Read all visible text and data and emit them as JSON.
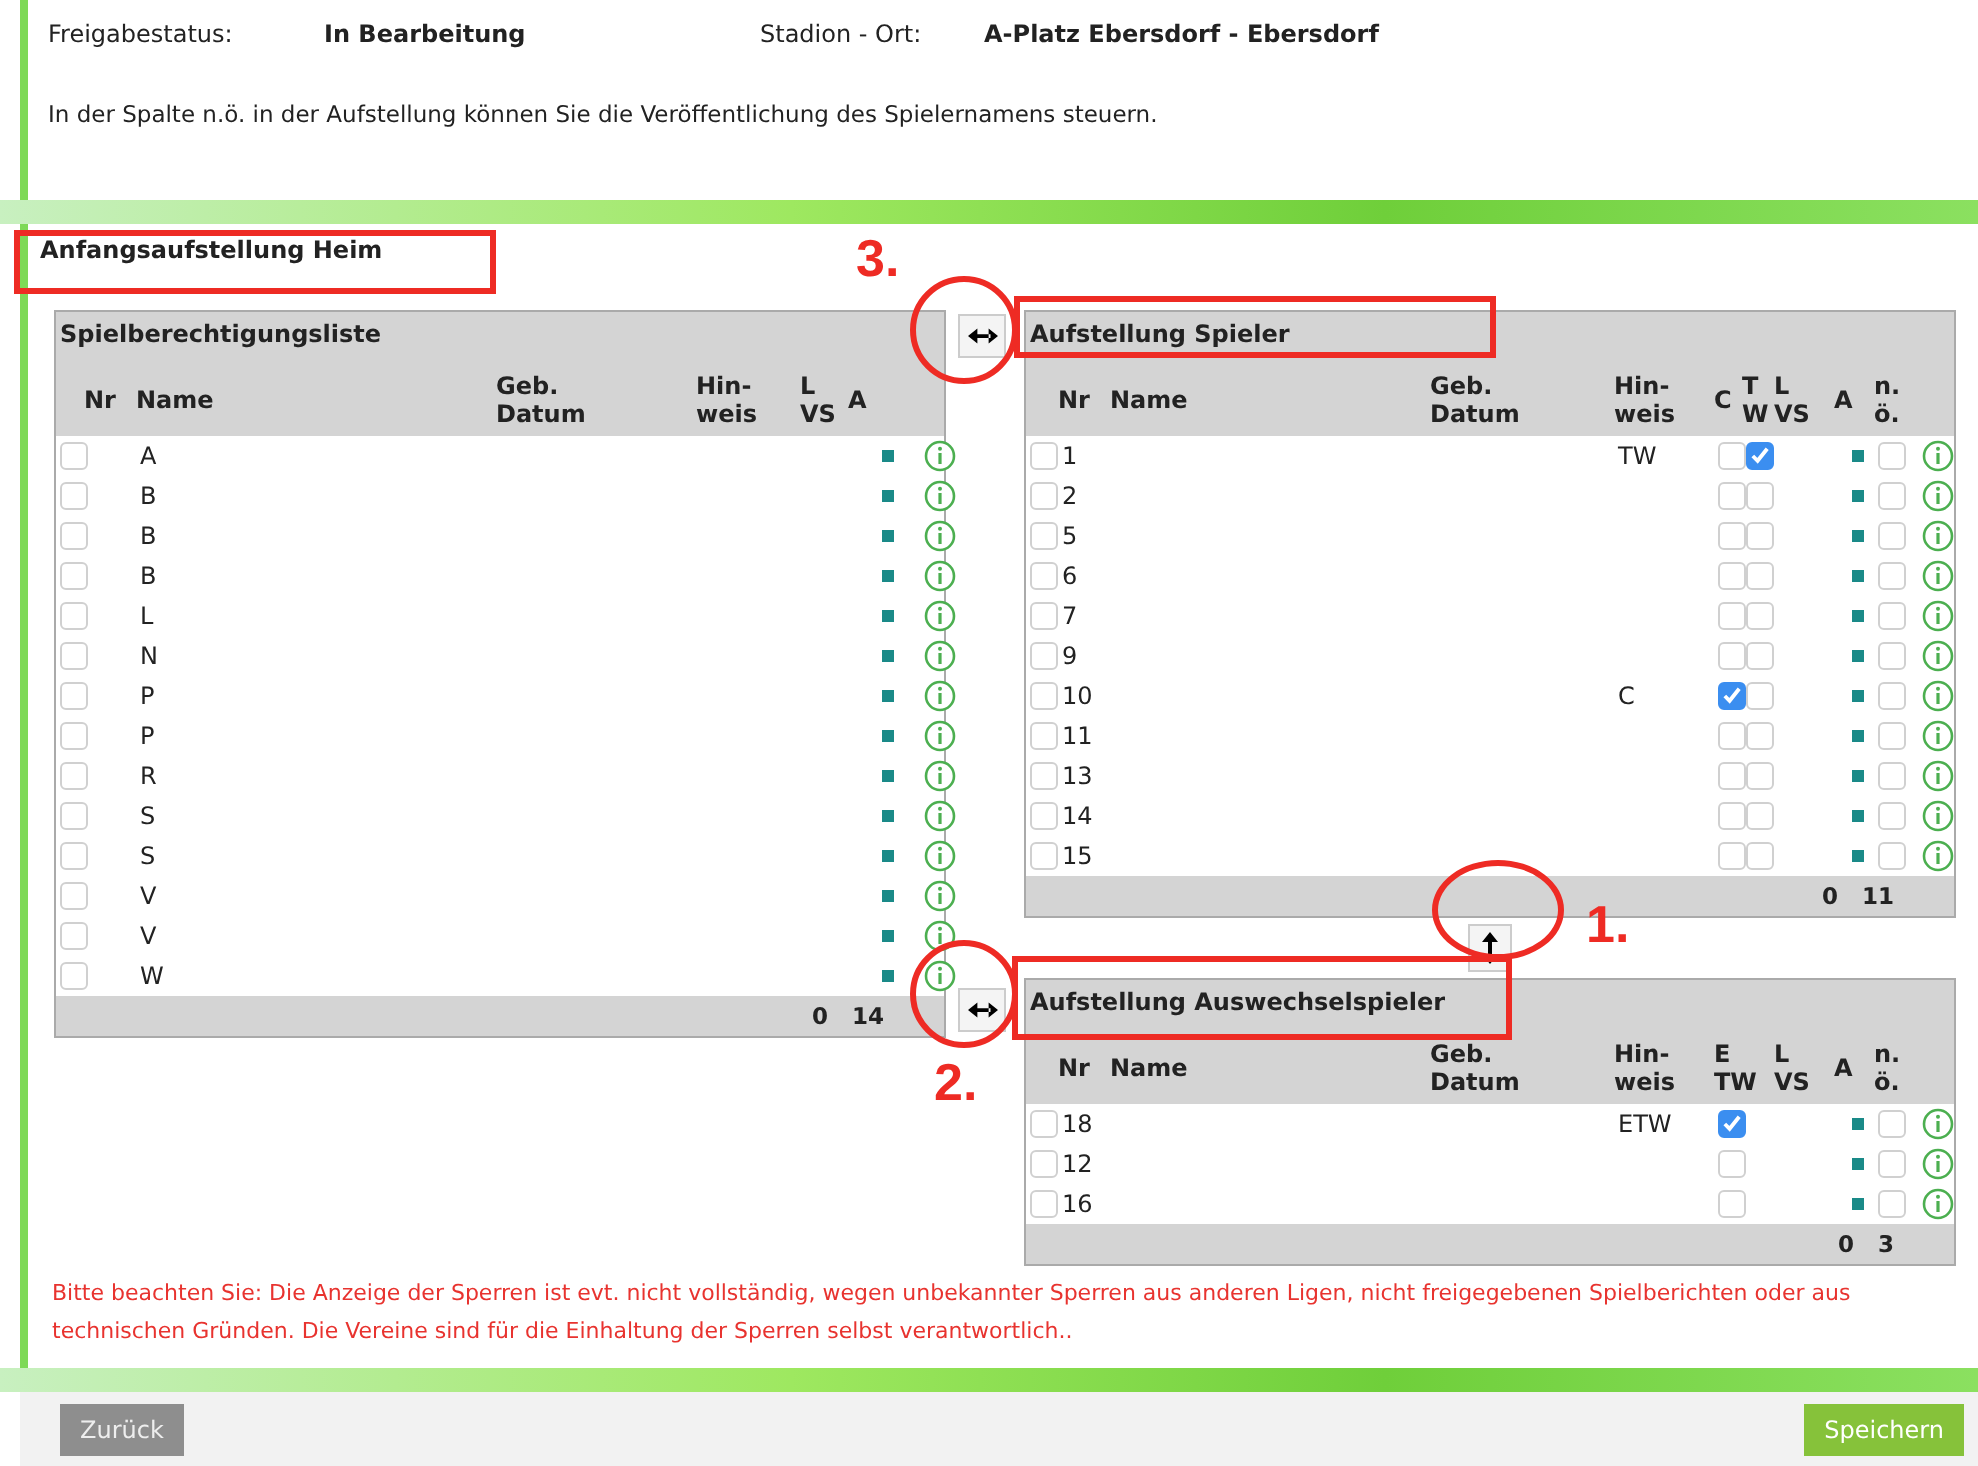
{
  "header": {
    "fields": [
      {
        "label": "Freigabestatus:",
        "value": "In Bearbeitung"
      },
      {
        "label": "Stadion - Ort:",
        "value": "A-Platz Ebersdorf - Ebersdorf"
      }
    ],
    "info": "In der Spalte n.ö. in der Aufstellung können Sie die Veröffentlichung des Spielernamens steuern."
  },
  "section_title": "Anfangsaufstellung Heim",
  "eligible": {
    "title": "Spielberechtigungsliste",
    "columns": [
      "Nr",
      "Name",
      "Geb.\nDatum",
      "Hin-\nweis",
      "L\nVS",
      "A"
    ],
    "rows": [
      {
        "name": "A",
        "checked": false
      },
      {
        "name": "B",
        "checked": false
      },
      {
        "name": "B",
        "checked": false
      },
      {
        "name": "B",
        "checked": false
      },
      {
        "name": "L",
        "checked": false
      },
      {
        "name": "N",
        "checked": false
      },
      {
        "name": "P",
        "checked": false
      },
      {
        "name": "P",
        "checked": false
      },
      {
        "name": "R",
        "checked": false
      },
      {
        "name": "S",
        "checked": false
      },
      {
        "name": "S",
        "checked": false
      },
      {
        "name": "V",
        "checked": false
      },
      {
        "name": "V",
        "checked": false
      },
      {
        "name": "W",
        "checked": false
      }
    ],
    "footer": [
      "0",
      "14"
    ]
  },
  "lineup": {
    "title": "Aufstellung Spieler",
    "columns": [
      "Nr",
      "Name",
      "Geb.\nDatum",
      "Hin-\nweis",
      "C",
      "T\nW",
      "L\nVS",
      "A",
      "n.\nö."
    ],
    "rows": [
      {
        "nr": "1",
        "hinweis": "TW",
        "checked": false,
        "captain": false,
        "keeper": true,
        "hidden": false
      },
      {
        "nr": "2",
        "checked": false,
        "captain": false,
        "keeper": false,
        "hidden": false
      },
      {
        "nr": "5",
        "checked": false,
        "captain": false,
        "keeper": false,
        "hidden": false
      },
      {
        "nr": "6",
        "checked": false,
        "captain": false,
        "keeper": false,
        "hidden": false
      },
      {
        "nr": "7",
        "checked": false,
        "captain": false,
        "keeper": false,
        "hidden": false
      },
      {
        "nr": "9",
        "checked": false,
        "captain": false,
        "keeper": false,
        "hidden": false
      },
      {
        "nr": "10",
        "hinweis": "C",
        "checked": false,
        "captain": true,
        "keeper": false,
        "hidden": false
      },
      {
        "nr": "11",
        "checked": false,
        "captain": false,
        "keeper": false,
        "hidden": false
      },
      {
        "nr": "13",
        "checked": false,
        "captain": false,
        "keeper": false,
        "hidden": false
      },
      {
        "nr": "14",
        "checked": false,
        "captain": false,
        "keeper": false,
        "hidden": false
      },
      {
        "nr": "15",
        "checked": false,
        "captain": false,
        "keeper": false,
        "hidden": false
      }
    ],
    "footer": [
      "0",
      "11"
    ]
  },
  "subs": {
    "title": "Aufstellung Auswechselspieler",
    "columns": [
      "Nr",
      "Name",
      "Geb.\nDatum",
      "Hin-\nweis",
      "E\nTW",
      "L\nVS",
      "A",
      "n.\nö."
    ],
    "rows": [
      {
        "nr": "18",
        "hinweis": "ETW",
        "checked": false,
        "keeper": true,
        "hidden": false
      },
      {
        "nr": "12",
        "checked": false,
        "keeper": false,
        "hidden": false
      },
      {
        "nr": "16",
        "checked": false,
        "keeper": false,
        "hidden": false
      }
    ],
    "footer": [
      "0",
      "3"
    ]
  },
  "annotations": [
    {
      "label": "3."
    },
    {
      "label": "1."
    },
    {
      "label": "2."
    }
  ],
  "notice": "Bitte beachten Sie: Die Anzeige der Sperren ist evt. nicht vollständig, wegen unbekannter Sperren aus anderen Ligen, nicht freigegebenen Spielberichten oder aus technischen Gründen. Die Vereine sind für die Einhaltung der Sperren selbst verantwortlich..",
  "buttons": {
    "back": "Zurück",
    "save": "Speichern"
  }
}
